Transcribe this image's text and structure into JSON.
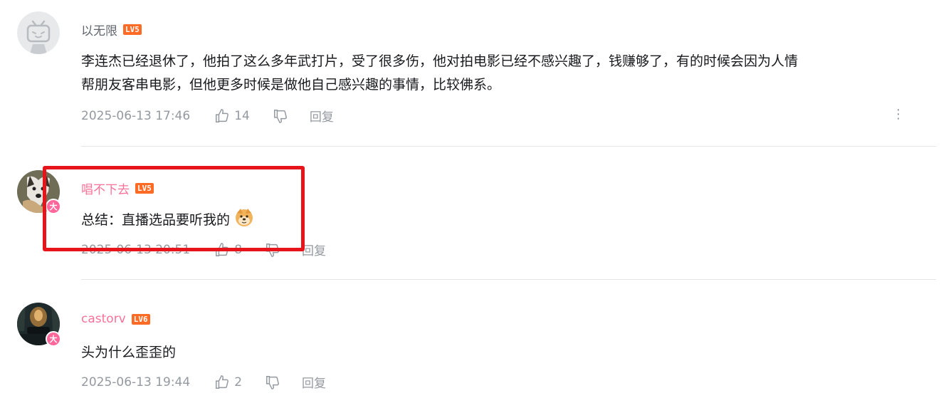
{
  "comments": [
    {
      "username": "以无限",
      "level": "LV5",
      "content_line1": "李连杰已经退休了，他拍了这么多年武打片，受了很多伤，他对拍电影已经不感兴趣了，钱赚够了，有的时候会因为人情",
      "content_line2": "帮朋友客串电影，但他更多时候是做他自己感兴趣的事情，比较佛系。",
      "time": "2025-06-13 17:46",
      "likes": "14",
      "reply_label": "回复",
      "avatar_icon": "default-tv-avatar-icon"
    },
    {
      "username": "唱不下去",
      "level": "LV5",
      "badge": "大",
      "content": "总结：直播选品要听我的",
      "emoji_icon": "doge-emoji-icon",
      "time": "2025-06-13 20:51",
      "likes": "8",
      "reply_label": "回复"
    },
    {
      "username": "castorv",
      "level": "LV6",
      "badge": "大",
      "content": "头为什么歪歪的",
      "time": "2025-06-13 19:44",
      "likes": "2",
      "reply_label": "回复"
    }
  ],
  "colors": {
    "accent_pink": "#fb7299",
    "level_orange": "#ff6a24",
    "highlight_red": "#e8141c",
    "meta_gray": "#9499a0"
  }
}
